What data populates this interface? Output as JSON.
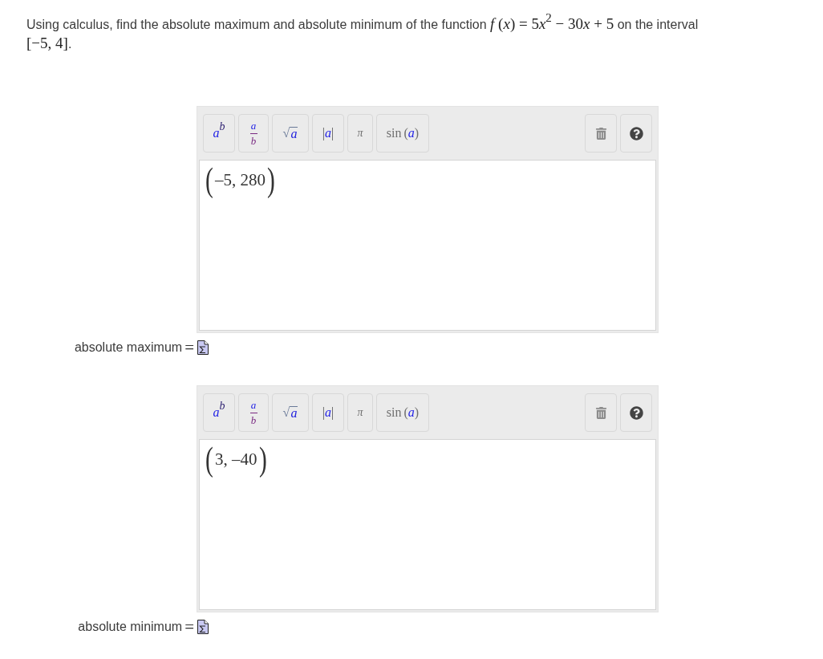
{
  "question": {
    "text_before": "Using calculus, find the absolute maximum and absolute minimum of the function",
    "function": [
      {
        "kind": "variable",
        "text": "f"
      },
      {
        "kind": "plain",
        "text": " ("
      },
      {
        "kind": "variable",
        "text": "x"
      },
      {
        "kind": "plain",
        "text": ") = 5"
      },
      {
        "kind": "variable",
        "text": "x"
      },
      {
        "kind": "exponent",
        "text": "2"
      },
      {
        "kind": "plain",
        "text": " − 30"
      },
      {
        "kind": "variable",
        "text": "x"
      },
      {
        "kind": "plain",
        "text": " + 5"
      }
    ],
    "text_after": "on the interval",
    "interval": "[−5, 4]",
    "end": "."
  },
  "answers": [
    {
      "label": "absolute maximum",
      "relation": "=",
      "editor": {
        "toolbar": [
          {
            "kind": "power",
            "base": "a",
            "exponent": "b"
          },
          {
            "kind": "fraction",
            "numerator": "a",
            "denominator": "b"
          },
          {
            "kind": "root",
            "radical": "√",
            "radicand": "a"
          },
          {
            "kind": "absolute",
            "left": "|",
            "argument": "a",
            "right": "|"
          },
          {
            "kind": "symbol",
            "label": "π"
          },
          {
            "kind": "function",
            "name": "sin",
            "open": "(",
            "argument": "a",
            "close": ")"
          }
        ],
        "value": {
          "left": "(",
          "expression": "–5, 280",
          "right": ")"
        }
      }
    },
    {
      "label": "absolute minimum",
      "relation": "=",
      "editor": {
        "toolbar": [
          {
            "kind": "power",
            "base": "a",
            "exponent": "b"
          },
          {
            "kind": "fraction",
            "numerator": "a",
            "denominator": "b"
          },
          {
            "kind": "root",
            "radical": "√",
            "radicand": "a"
          },
          {
            "kind": "absolute",
            "left": "|",
            "argument": "a",
            "right": "|"
          },
          {
            "kind": "symbol",
            "label": "π"
          },
          {
            "kind": "function",
            "name": "sin",
            "open": "(",
            "argument": "a",
            "close": ")"
          }
        ],
        "value": {
          "left": "(",
          "expression": "3, –40",
          "right": ")"
        }
      }
    }
  ]
}
